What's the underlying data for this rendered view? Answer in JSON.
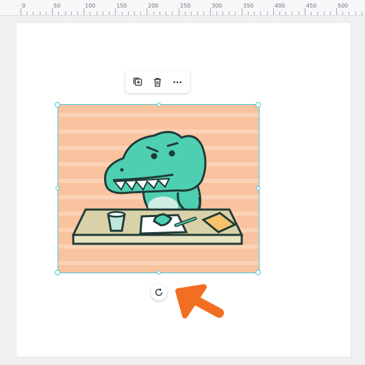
{
  "ruler": {
    "labels": [
      "0",
      "50",
      "100",
      "150",
      "200",
      "250",
      "300",
      "350",
      "400",
      "450",
      "500"
    ]
  },
  "toolbar": {
    "duplicate_icon": "duplicate-icon",
    "delete_icon": "trash-icon",
    "more_icon": "more-options-icon",
    "more_label": "···"
  },
  "image": {
    "subject": "crocodile-illustration",
    "background_color": "#f9c3a0",
    "stripe_color": "#fbd2b6"
  },
  "selection": {
    "border_color": "#3ec9d6"
  },
  "rotate": {
    "icon": "rotate-icon"
  },
  "annotation": {
    "arrow_color": "#f26f22"
  }
}
